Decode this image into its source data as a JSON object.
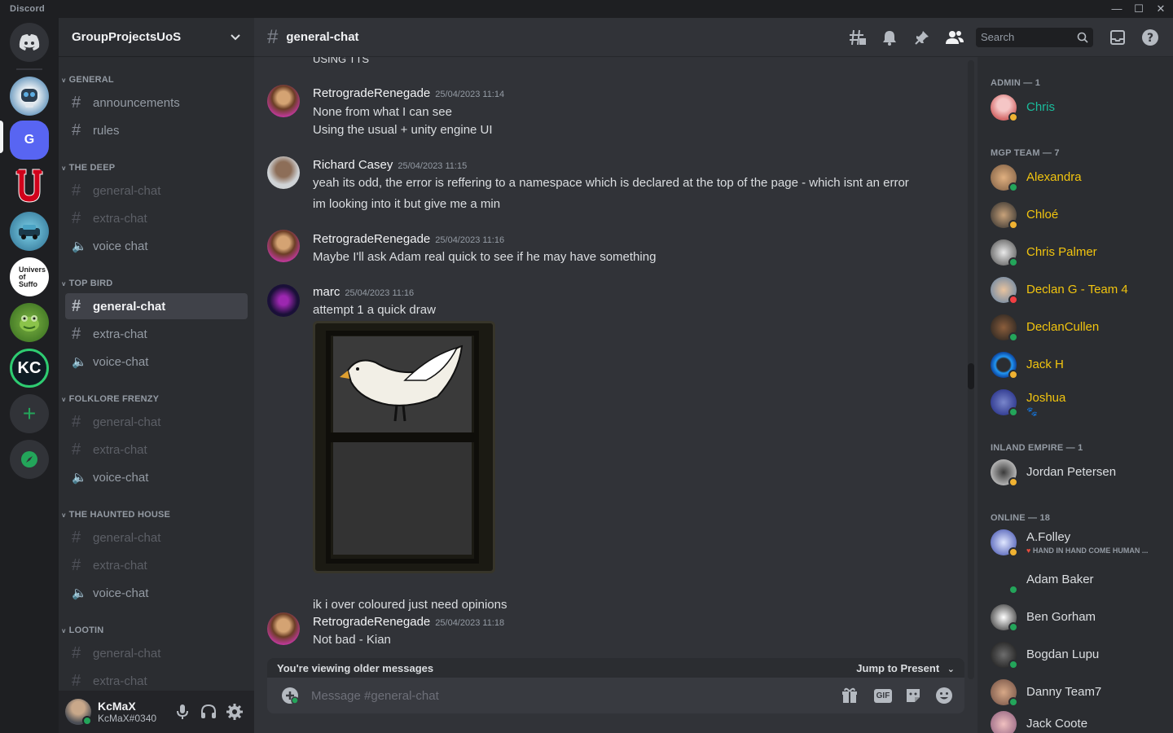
{
  "app": {
    "title": "Discord"
  },
  "server": {
    "name": "GroupProjectsUoS",
    "selected_icon_letter": "G",
    "uni_label": "Univers of Suffo",
    "kc_label": "KC"
  },
  "categories": [
    {
      "name": "GENERAL",
      "channels": [
        {
          "name": "announcements",
          "type": "text",
          "state": "normal"
        },
        {
          "name": "rules",
          "type": "text",
          "state": "normal"
        }
      ]
    },
    {
      "name": "THE DEEP",
      "channels": [
        {
          "name": "general-chat",
          "type": "text",
          "state": "muted"
        },
        {
          "name": "extra-chat",
          "type": "text",
          "state": "muted"
        },
        {
          "name": "voice chat",
          "type": "voice",
          "state": "normal"
        }
      ]
    },
    {
      "name": "TOP BIRD",
      "channels": [
        {
          "name": "general-chat",
          "type": "text",
          "state": "active"
        },
        {
          "name": "extra-chat",
          "type": "text",
          "state": "normal"
        },
        {
          "name": "voice-chat",
          "type": "voice",
          "state": "normal"
        }
      ]
    },
    {
      "name": "FOLKLORE FRENZY",
      "channels": [
        {
          "name": "general-chat",
          "type": "text",
          "state": "muted"
        },
        {
          "name": "extra-chat",
          "type": "text",
          "state": "muted"
        },
        {
          "name": "voice-chat",
          "type": "voice",
          "state": "normal"
        }
      ]
    },
    {
      "name": "THE HAUNTED HOUSE",
      "channels": [
        {
          "name": "general-chat",
          "type": "text",
          "state": "muted"
        },
        {
          "name": "extra-chat",
          "type": "text",
          "state": "muted"
        },
        {
          "name": "voice-chat",
          "type": "voice",
          "state": "normal"
        }
      ]
    },
    {
      "name": "LOOTIN",
      "channels": [
        {
          "name": "general-chat",
          "type": "text",
          "state": "muted"
        },
        {
          "name": "extra-chat",
          "type": "text",
          "state": "muted"
        }
      ]
    }
  ],
  "user": {
    "name": "KcMaX",
    "tag": "KcMaX#0340"
  },
  "channel": {
    "name": "general-chat"
  },
  "search": {
    "placeholder": "Search"
  },
  "messages": {
    "partial_top": "USING TTS",
    "m1": {
      "author": "RetrogradeRenegade",
      "time": "25/04/2023 11:14",
      "lines": [
        "None from what I can see",
        "Using the usual + unity engine UI"
      ]
    },
    "m2": {
      "author": "Richard Casey",
      "time": "25/04/2023 11:15",
      "lines": [
        "yeah its odd, the error is reffering to a namespace which is declared at the top of the page - which isnt an error",
        "im looking into it but give me a min"
      ]
    },
    "m3": {
      "author": "RetrogradeRenegade",
      "time": "25/04/2023 11:16",
      "lines": [
        "Maybe I'll ask Adam real quick to see if he may have something"
      ]
    },
    "m4": {
      "author": "marc",
      "time": "25/04/2023 11:16",
      "lines": [
        "attempt 1 a quick draw",
        "ik i over coloured just need opinions"
      ]
    },
    "m5": {
      "author": "RetrogradeRenegade",
      "time": "25/04/2023 11:18",
      "lines": [
        "Not bad - Kian"
      ]
    }
  },
  "older_bar": {
    "text": "You're viewing older messages",
    "jump": "Jump to Present"
  },
  "composer": {
    "placeholder": "Message #general-chat",
    "gif": "GIF"
  },
  "members": {
    "groups": [
      {
        "title": "ADMIN — 1"
      },
      {
        "title": "MGP TEAM — 7"
      },
      {
        "title": "INLAND EMPIRE — 1"
      },
      {
        "title": "ONLINE — 18"
      }
    ],
    "admin": [
      {
        "name": "Chris",
        "color": "#1abc9c",
        "status": "idle"
      }
    ],
    "mgp": [
      {
        "name": "Alexandra",
        "color": "#f1c40f",
        "status": "online"
      },
      {
        "name": "Chloé",
        "color": "#f1c40f",
        "status": "idle"
      },
      {
        "name": "Chris Palmer",
        "color": "#f1c40f",
        "status": "online"
      },
      {
        "name": "Declan G - Team 4",
        "color": "#f1c40f",
        "status": "dnd"
      },
      {
        "name": "DeclanCullen",
        "color": "#f1c40f",
        "status": "online"
      },
      {
        "name": "Jack H",
        "color": "#f1c40f",
        "status": "idle"
      },
      {
        "name": "Joshua",
        "color": "#f1c40f",
        "status": "online"
      }
    ],
    "inland": [
      {
        "name": "Jordan Petersen",
        "color": "#dbdee1",
        "status": "idle"
      }
    ],
    "online": [
      {
        "name": "A.Folley",
        "sub": "HAND IN HAND COME HUMAN ...",
        "color": "#dbdee1",
        "status": "idle"
      },
      {
        "name": "Adam Baker",
        "color": "#dbdee1",
        "status": "online"
      },
      {
        "name": "Ben Gorham",
        "color": "#dbdee1",
        "status": "online"
      },
      {
        "name": "Bogdan Lupu",
        "color": "#dbdee1",
        "status": "online"
      },
      {
        "name": "Danny Team7",
        "color": "#dbdee1",
        "status": "online"
      },
      {
        "name": "Jack Coote",
        "color": "#dbdee1",
        "status": "online"
      }
    ]
  }
}
